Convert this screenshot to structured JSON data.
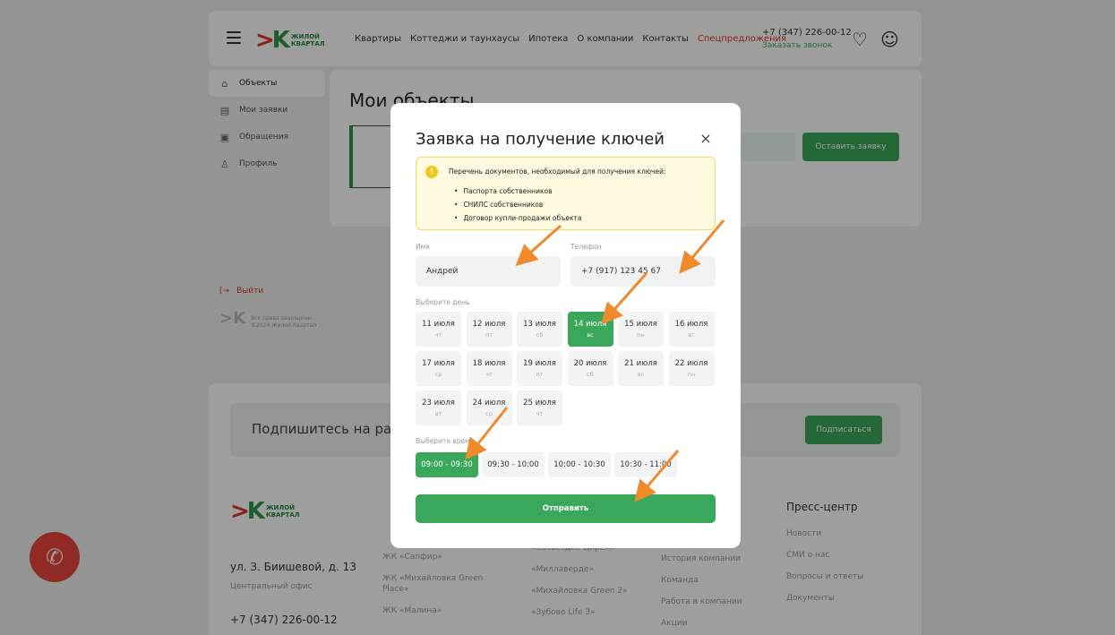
{
  "header": {
    "logo_line1": "ЖИЛОЙ",
    "logo_line2": "КВАРТАЛ",
    "nav": [
      "Квартиры",
      "Коттеджи и таунхаусы",
      "Ипотека",
      "О компании",
      "Контакты",
      "Спецпредложения"
    ],
    "phone": "+7 (347) 226-00-12",
    "callback": "Заказать звонок"
  },
  "sidebar": {
    "items": [
      "Объекты",
      "Мои заявки",
      "Обращения",
      "Профиль"
    ],
    "logout": "Выйти",
    "copyright_line1": "Все права защищены",
    "copyright_line2": "©2024 Жилой Квартал"
  },
  "content": {
    "title": "Мои объекты",
    "leave_request": "Оставить заявку"
  },
  "footer": {
    "subscribe_text": "Подпишитесь на рассылку",
    "subscribe_button": "Подписаться",
    "address": "ул. З. Биишевой, д. 13",
    "office": "Центральный офис",
    "phone": "+7 (347) 226-00-12",
    "col1": [
      "ЖК «Сапфир»",
      "ЖК «Михайловка Green Place»",
      "ЖК «Малина»"
    ],
    "col2": [
      "«Созвездие Цирем»",
      "«Миллаверде»",
      "«Михайловка Green 2»",
      "«Зубово Life 3»"
    ],
    "col3": [
      "История компании",
      "Команда",
      "Работа в компании",
      "Акции"
    ],
    "press_title": "Пресс-центр",
    "press": [
      "Новости",
      "СМИ о нас",
      "Вопросы и ответы",
      "Документы"
    ]
  },
  "modal": {
    "title": "Заявка на получение ключей",
    "close": "×",
    "notice_title": "Перечень документов, необходимый для получения ключей:",
    "notice_items": [
      "Паспорта собственников",
      "СНИЛС собственников",
      "Договор купли-продажи объекта"
    ],
    "name_label": "Имя",
    "name_value": "Андрей",
    "phone_label": "Телефон",
    "phone_value": "+7 (917) 123 45 67",
    "day_label": "Выберите день",
    "days": [
      {
        "d": "11 июля",
        "w": "чт"
      },
      {
        "d": "12 июля",
        "w": "пт"
      },
      {
        "d": "13 июля",
        "w": "сб"
      },
      {
        "d": "14 июля",
        "w": "вс"
      },
      {
        "d": "15 июля",
        "w": "пн"
      },
      {
        "d": "16 июля",
        "w": "вт"
      },
      {
        "d": "17 июля",
        "w": "ср"
      },
      {
        "d": "18 июля",
        "w": "чт"
      },
      {
        "d": "19 июля",
        "w": "пт"
      },
      {
        "d": "20 июля",
        "w": "сб"
      },
      {
        "d": "21 июля",
        "w": "вс"
      },
      {
        "d": "22 июля",
        "w": "пн"
      },
      {
        "d": "23 июля",
        "w": "вт"
      },
      {
        "d": "24 июля",
        "w": "ср"
      },
      {
        "d": "25 июля",
        "w": "чт"
      }
    ],
    "selected_day_index": 3,
    "time_label": "Выберите время",
    "slots": [
      "09:00 - 09:30",
      "09:30 - 10:00",
      "10:00 - 10:30",
      "10:30 - 11:00"
    ],
    "selected_slot_index": 0,
    "submit": "Отправить"
  },
  "colors": {
    "accent_green": "#3aa85a",
    "accent_red": "#e0352b",
    "notice_bg": "#fffbe0",
    "arrow": "#f08a2c"
  }
}
